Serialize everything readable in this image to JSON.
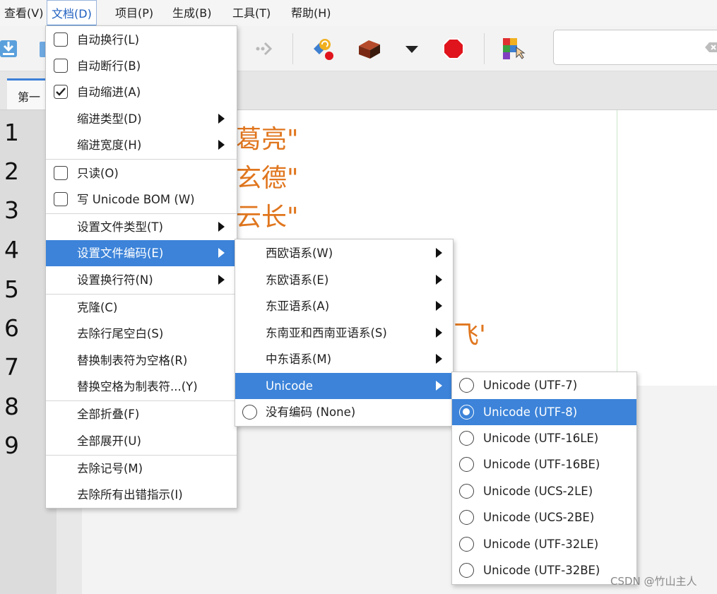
{
  "menubar": {
    "items": [
      {
        "label": "查看(V)"
      },
      {
        "label": "文档(D)"
      },
      {
        "label": "项目(P)"
      },
      {
        "label": "生成(B)"
      },
      {
        "label": "工具(T)"
      },
      {
        "label": "帮助(H)"
      }
    ]
  },
  "tab": {
    "label": "第一"
  },
  "editor": {
    "line_numbers": [
      "1",
      "2",
      "3",
      "4",
      "5",
      "6",
      "7",
      "8",
      "9"
    ],
    "visible_code": [
      "葛亮\"",
      "玄德\"",
      "云长\"",
      "飞'"
    ]
  },
  "document_menu": {
    "items": [
      {
        "label": "自动换行(L)",
        "checked": false
      },
      {
        "label": "自动断行(B)",
        "checked": false
      },
      {
        "label": "自动缩进(A)",
        "checked": true
      },
      {
        "label": "缩进类型(D)"
      },
      {
        "label": "缩进宽度(H)"
      },
      {
        "label": "只读(O)",
        "checked": false
      },
      {
        "label": "写 Unicode BOM (W)",
        "checked": false
      },
      {
        "label": "设置文件类型(T)"
      },
      {
        "label": "设置文件编码(E)"
      },
      {
        "label": "设置换行符(N)"
      },
      {
        "label": "克隆(C)"
      },
      {
        "label": "去除行尾空白(S)"
      },
      {
        "label": "替换制表符为空格(R)"
      },
      {
        "label": "替换空格为制表符...(Y)"
      },
      {
        "label": "全部折叠(F)"
      },
      {
        "label": "全部展开(U)"
      },
      {
        "label": "去除记号(M)"
      },
      {
        "label": "去除所有出错指示(I)"
      }
    ]
  },
  "encoding_menu": {
    "items": [
      {
        "label": "西欧语系(W)"
      },
      {
        "label": "东欧语系(E)"
      },
      {
        "label": "东亚语系(A)"
      },
      {
        "label": "东南亚和西南亚语系(S)"
      },
      {
        "label": "中东语系(M)"
      },
      {
        "label": "Unicode"
      },
      {
        "label": "没有编码 (None)"
      }
    ]
  },
  "unicode_menu": {
    "items": [
      {
        "label": "Unicode (UTF-7)",
        "selected": false
      },
      {
        "label": "Unicode (UTF-8)",
        "selected": true
      },
      {
        "label": "Unicode (UTF-16LE)",
        "selected": false
      },
      {
        "label": "Unicode (UTF-16BE)",
        "selected": false
      },
      {
        "label": "Unicode (UCS-2LE)",
        "selected": false
      },
      {
        "label": "Unicode (UCS-2BE)",
        "selected": false
      },
      {
        "label": "Unicode (UTF-32LE)",
        "selected": false
      },
      {
        "label": "Unicode (UTF-32BE)",
        "selected": false
      }
    ]
  },
  "watermark": "CSDN @竹山主人",
  "colors": {
    "accent": "#3c83d9",
    "code_text": "#e0761e",
    "stop": "#e0141c"
  }
}
